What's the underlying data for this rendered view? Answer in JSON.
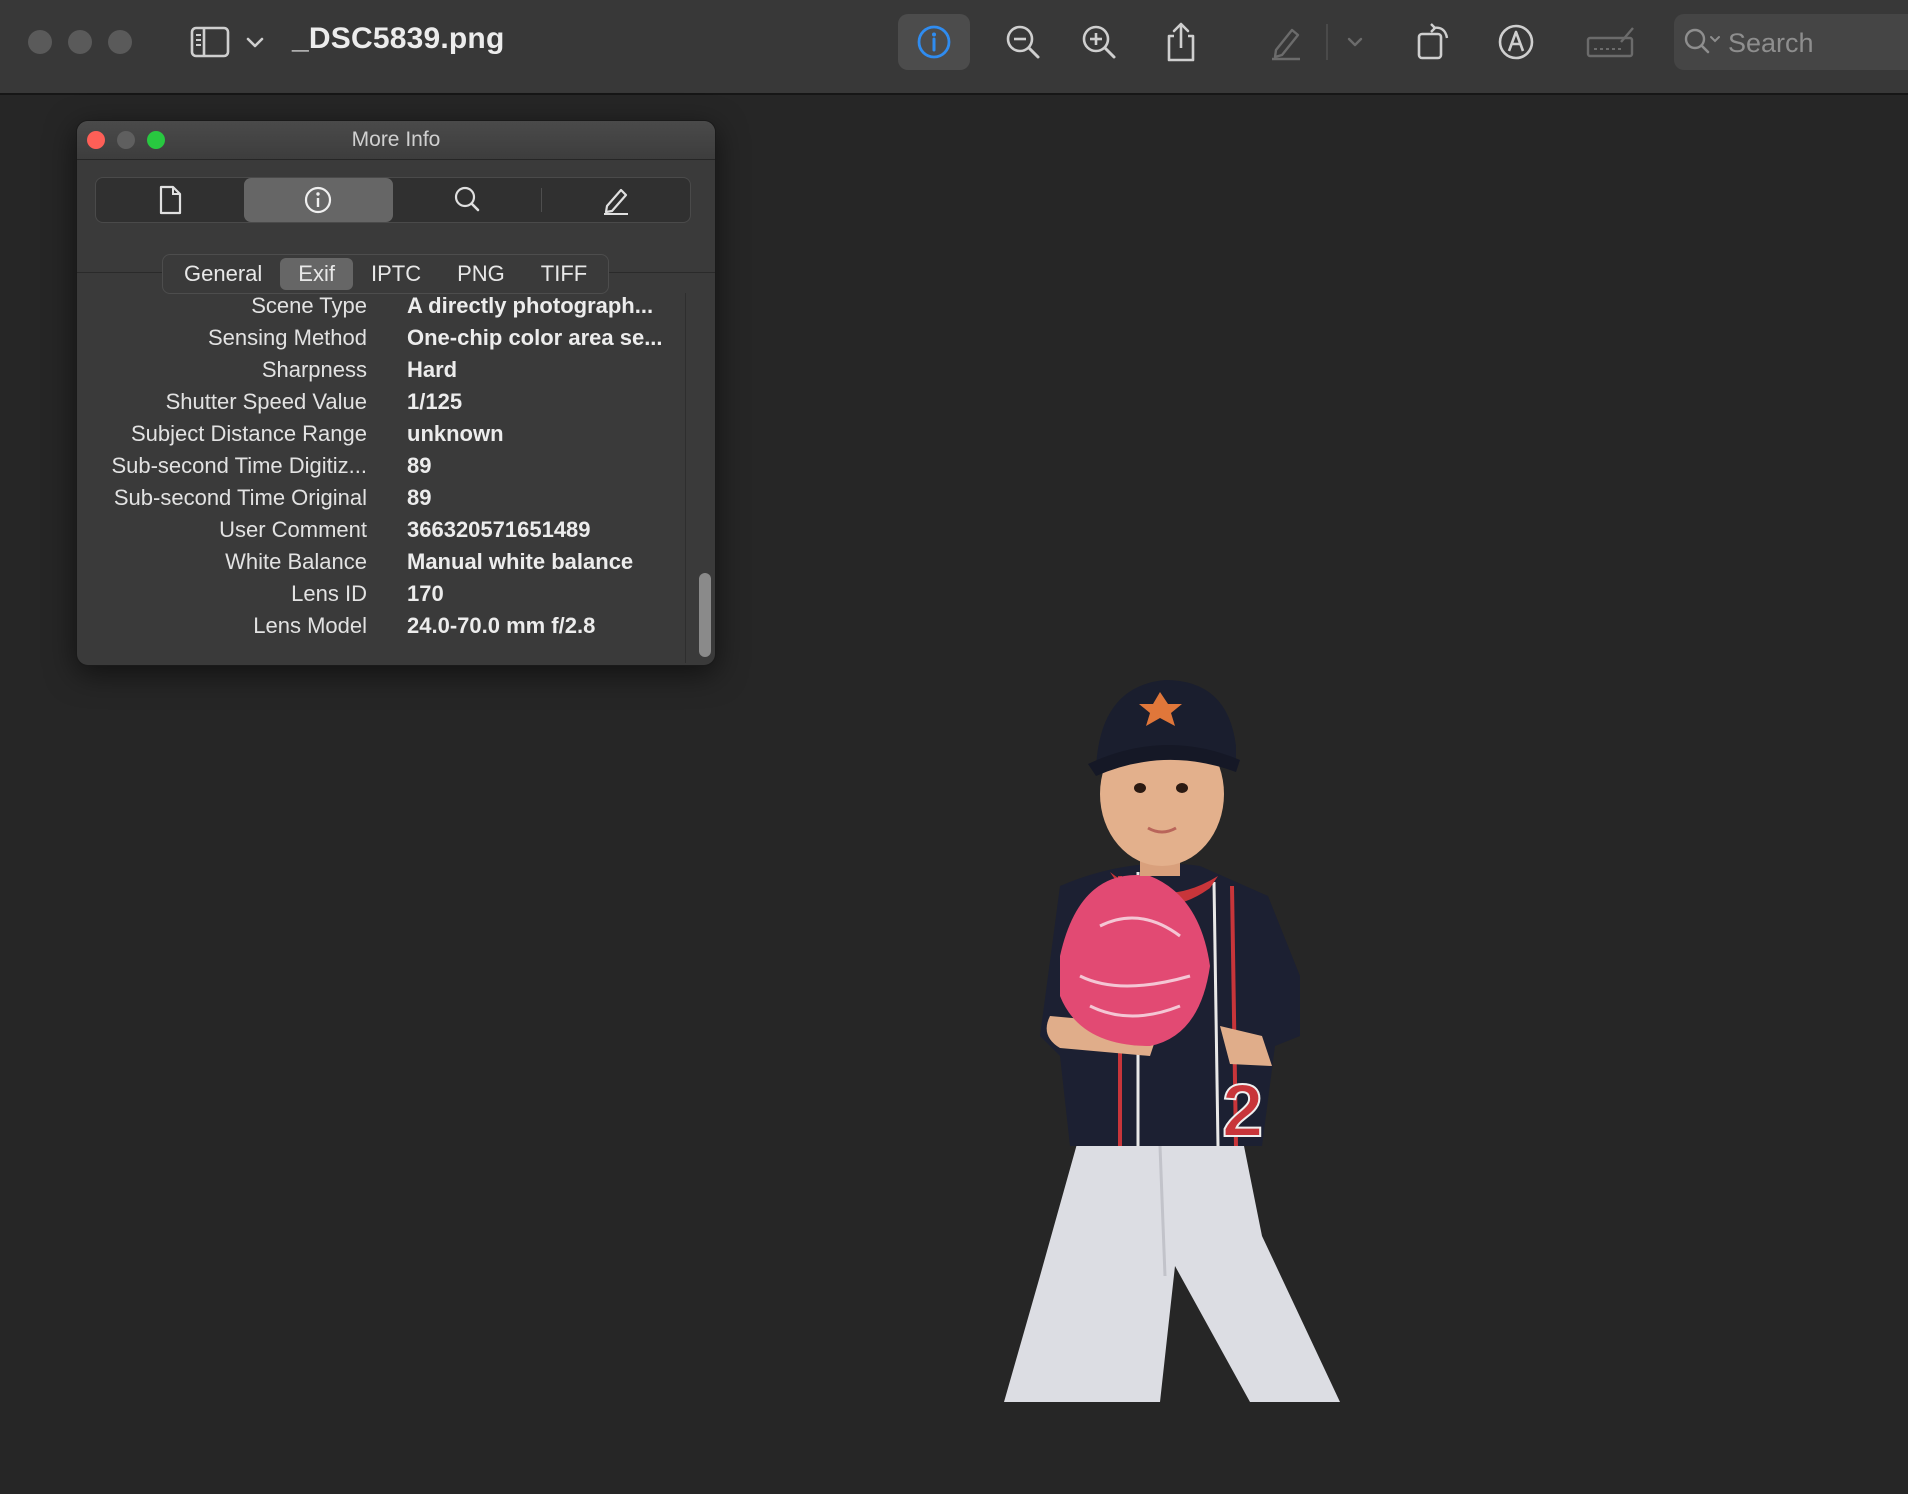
{
  "window": {
    "title": "_DSC5839.png"
  },
  "toolbar": {
    "search_placeholder": "Search",
    "icons": [
      "sidebar-toggle-icon",
      "chevron-down-icon",
      "info-icon",
      "zoom-out-icon",
      "zoom-in-icon",
      "share-icon",
      "markup-pen-icon",
      "chevron-down-icon",
      "rotate-icon",
      "markup-circle-a-icon",
      "signature-icon",
      "search-icon"
    ],
    "accent_color": "#2f8cf0"
  },
  "more_info": {
    "title": "More Info",
    "inspector_tabs": [
      "document-icon",
      "info-icon",
      "search-icon",
      "pencil-icon"
    ],
    "active_inspector_tab": "info",
    "subtabs": [
      "General",
      "Exif",
      "IPTC",
      "PNG",
      "TIFF"
    ],
    "active_subtab": "Exif",
    "rows": [
      {
        "key": "Scene Type",
        "value": "A directly photograph..."
      },
      {
        "key": "Sensing Method",
        "value": "One-chip color area se..."
      },
      {
        "key": "Sharpness",
        "value": "Hard"
      },
      {
        "key": "Shutter Speed Value",
        "value": "1/125"
      },
      {
        "key": "Subject Distance Range",
        "value": "unknown"
      },
      {
        "key": "Sub-second Time Digitiz...",
        "value": "89"
      },
      {
        "key": "Sub-second Time Original",
        "value": "89"
      },
      {
        "key": "User Comment",
        "value": "366320571651489"
      },
      {
        "key": "White Balance",
        "value": "Manual white balance"
      },
      {
        "key": "Lens ID",
        "value": "170"
      },
      {
        "key": "Lens Model",
        "value": "24.0-70.0 mm f/2.8"
      }
    ]
  }
}
